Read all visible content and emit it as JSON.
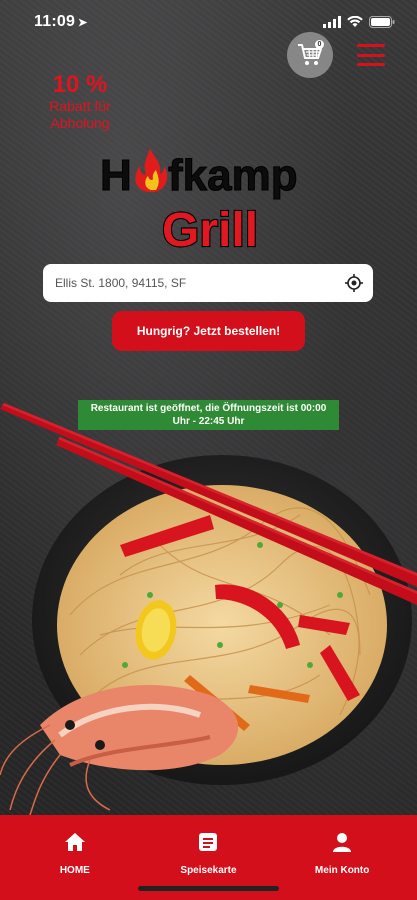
{
  "status_bar": {
    "time": "11:09",
    "location_glyph": "➤"
  },
  "header": {
    "cart_icon": "cart-icon",
    "cart_count": "0",
    "menu_icon": "hamburger-menu-icon"
  },
  "promo": {
    "percent": "10 %",
    "text": "Rabatt für Abholung"
  },
  "logo": {
    "line1_start": "H",
    "line1_end": "fkamp",
    "line2": "Grill"
  },
  "address": {
    "value": "Ellis St. 1800, 94115, SF"
  },
  "order_button": {
    "label": "Hungrig? Jetzt bestellen!"
  },
  "open_banner": {
    "text": "Restaurant ist geöffnet, die Öffnungszeit ist 00:00 Uhr - 22:45 Uhr"
  },
  "tabs": [
    {
      "label": "HOME",
      "icon": "home-icon"
    },
    {
      "label": "Speisekarte",
      "icon": "menu-list-icon"
    },
    {
      "label": "Mein Konto",
      "icon": "user-icon"
    }
  ],
  "colors": {
    "brand_red": "#d40f1c",
    "banner_green": "#2f8a35"
  }
}
